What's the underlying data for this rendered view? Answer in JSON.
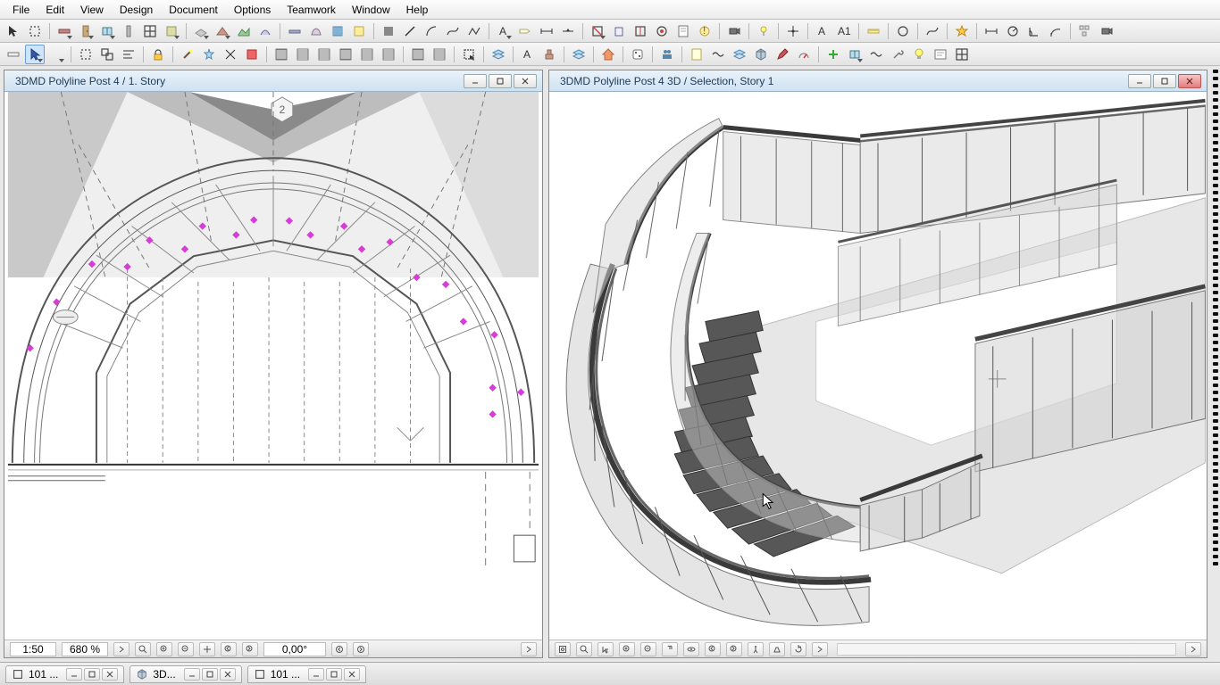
{
  "menu": [
    "File",
    "Edit",
    "View",
    "Design",
    "Document",
    "Options",
    "Teamwork",
    "Window",
    "Help"
  ],
  "panes": {
    "left": {
      "title": "3DMD Polyline Post 4 / 1. Story"
    },
    "right": {
      "title": "3DMD Polyline Post 4 3D / Selection, Story 1"
    }
  },
  "status": {
    "scale": "1:50",
    "zoom": "680 %",
    "angle": "0,00°"
  },
  "tabs": [
    {
      "label": "101 ...",
      "icon": "layout"
    },
    {
      "label": "3D...",
      "icon": "cube"
    },
    {
      "label": "101 ...",
      "icon": "layout"
    }
  ],
  "toolbar_icons_row1": [
    "arrow",
    "marquee",
    "sep",
    "wall",
    "door",
    "window",
    "column",
    "grid",
    "object",
    "sep",
    "slab",
    "roof",
    "mesh",
    "shell",
    "sep",
    "beam",
    "morph",
    "curtain",
    "zone",
    "sep",
    "fill",
    "line",
    "arc",
    "spline",
    "polyline",
    "sep",
    "text",
    "label",
    "dim",
    "level",
    "sep",
    "section",
    "elevation",
    "ie",
    "detail",
    "worksheet",
    "change",
    "sep",
    "camera",
    "sep",
    "lamp",
    "sep",
    "hotspot",
    "sep",
    "A",
    "A1",
    "sep",
    "measure",
    "sep",
    "circle",
    "sep",
    "spline2",
    "sep",
    "star",
    "sep",
    "dim-chain",
    "dim-radial",
    "dim-angle",
    "dim-arc",
    "sep",
    "tree",
    "camera2"
  ],
  "toolbar_icons_row2": [
    "ruler",
    "cursor",
    "dd",
    "sep",
    "marquee2",
    "group",
    "align",
    "sep",
    "lock",
    "sep",
    "wand",
    "magic",
    "trim",
    "box",
    "sep",
    "hatch1",
    "hatch2",
    "hatch3",
    "hatch4",
    "hatch5",
    "hatch6",
    "sep",
    "hatch7",
    "hatch8",
    "sep",
    "sel",
    "sep",
    "layers",
    "sep",
    "Aa",
    "stamp",
    "sep",
    "layers2",
    "sep",
    "home",
    "sep",
    "dice",
    "sep",
    "people",
    "sep",
    "note",
    "wave",
    "layers3",
    "cube",
    "pen",
    "gauge",
    "sep",
    "plus",
    "window",
    "waves",
    "tools",
    "bulb",
    "textblock",
    "grid2"
  ]
}
